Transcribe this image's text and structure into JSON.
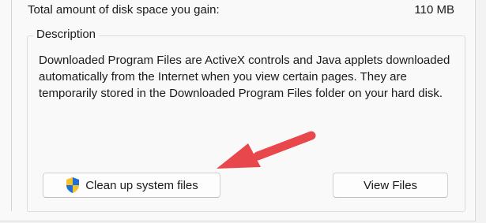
{
  "summary": {
    "label": "Total amount of disk space you gain:",
    "value": "110 MB"
  },
  "description": {
    "legend": "Description",
    "text": "Downloaded Program Files are ActiveX controls and Java applets downloaded automatically from the Internet when you view certain pages. They are temporarily stored in the Downloaded Program Files folder on your hard disk."
  },
  "buttons": {
    "cleanup_label": "Clean up system files",
    "cleanup_icon": "uac-shield-icon",
    "view_label": "View Files"
  },
  "annotation": {
    "arrow_color": "#e8474b"
  }
}
